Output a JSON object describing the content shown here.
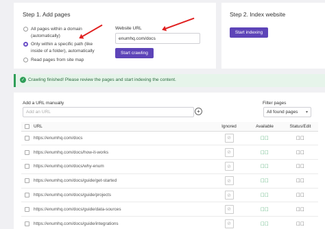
{
  "step1": {
    "title": "Step 1. Add pages",
    "options": [
      {
        "label_line1": "All pages within a domain",
        "label_line2": "(automatically)",
        "selected": false
      },
      {
        "label_line1": "Only within a specific path (like",
        "label_line2": "inside of a folder), automatically",
        "selected": true
      },
      {
        "label_line1": "Read pages from site map",
        "label_line2": "",
        "selected": false
      }
    ],
    "website_url_label": "Website URL",
    "website_url_value": "enumhq.com/docs",
    "crawl_button": "Start crawling"
  },
  "step2": {
    "title": "Step 2. Index website",
    "index_button": "Start indexing"
  },
  "alert": {
    "text": "Crawling finished! Please review the pages and start indexing the content.",
    "color": "#2f9e58"
  },
  "pages": {
    "add_url_label": "Add a URL manually",
    "add_url_placeholder": "Add an URL",
    "filter_label": "Filter pages",
    "filter_value": "All found pages",
    "columns": {
      "url": "URL",
      "ignored": "Ignored",
      "available": "Available",
      "status": "Status/Edit"
    },
    "rows": [
      {
        "url": "https://enumhq.com/docs"
      },
      {
        "url": "https://enumhq.com/docs/how-it-works"
      },
      {
        "url": "https://enumhq.com/docs/why-enum"
      },
      {
        "url": "https://enumhq.com/docs/guide/get-started"
      },
      {
        "url": "https://enumhq.com/docs/guide/projects"
      },
      {
        "url": "https://enumhq.com/docs/guide/data-sources"
      },
      {
        "url": "https://enumhq.com/docs/guide/integrations"
      }
    ]
  },
  "colors": {
    "accent": "#5d44b8",
    "annotation": "#e02020"
  }
}
